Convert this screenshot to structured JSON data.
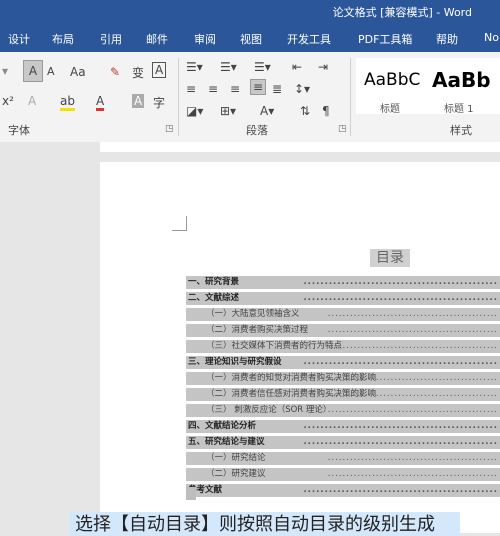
{
  "window": {
    "title": "论文格式 [兼容模式] - Word"
  },
  "tabs": [
    "设计",
    "布局",
    "引用",
    "邮件",
    "审阅",
    "视图",
    "开发工具",
    "PDF工具箱",
    "帮助",
    "No"
  ],
  "ribbon": {
    "font_group_label": "字体",
    "paragraph_group_label": "段落",
    "styles_group_label": "样式",
    "font_glyphs": {
      "grow": "A",
      "shrink": "A",
      "change_case": "Aa",
      "clear_format": "✎",
      "phonetic": "变",
      "border_char": "A",
      "superscript": "x²",
      "text_effect": "A",
      "highlight": "ab",
      "font_color": "A",
      "char_shading": "A",
      "circle_char": "字"
    },
    "styles": [
      {
        "sample": "AaBbC",
        "name": "标题"
      },
      {
        "sample": "AaBb",
        "name": "标题 1"
      }
    ]
  },
  "document": {
    "toc_title": "目录",
    "toc_entries": [
      {
        "level": 1,
        "text": "一、研究背景"
      },
      {
        "level": 1,
        "text": "二、文献综述"
      },
      {
        "level": 2,
        "text": "（一）大陆意见领袖含义"
      },
      {
        "level": 2,
        "text": "（二）消费者购买决策过程"
      },
      {
        "level": 2,
        "text": "（三）社交媒体下消费者的行为特点"
      },
      {
        "level": 1,
        "text": "三、理论知识与研究假设"
      },
      {
        "level": 2,
        "text": "（一）消费者的知觉对消费者购买决策的影响"
      },
      {
        "level": 2,
        "text": "（二）消费者信任感对消费者购买决策的影响"
      },
      {
        "level": 2,
        "text": "（三）  刺激反应论（SOR 理论）"
      },
      {
        "level": 1,
        "text": "四、文献结论分析"
      },
      {
        "level": 1,
        "text": "五、研究结论与建议"
      },
      {
        "level": 2,
        "text": "（一）研究结论"
      },
      {
        "level": 2,
        "text": "（二）研究建议"
      },
      {
        "level": 1,
        "text": "参考文献"
      }
    ]
  },
  "caption": "选择【自动目录】则按照自动目录的级别生成"
}
